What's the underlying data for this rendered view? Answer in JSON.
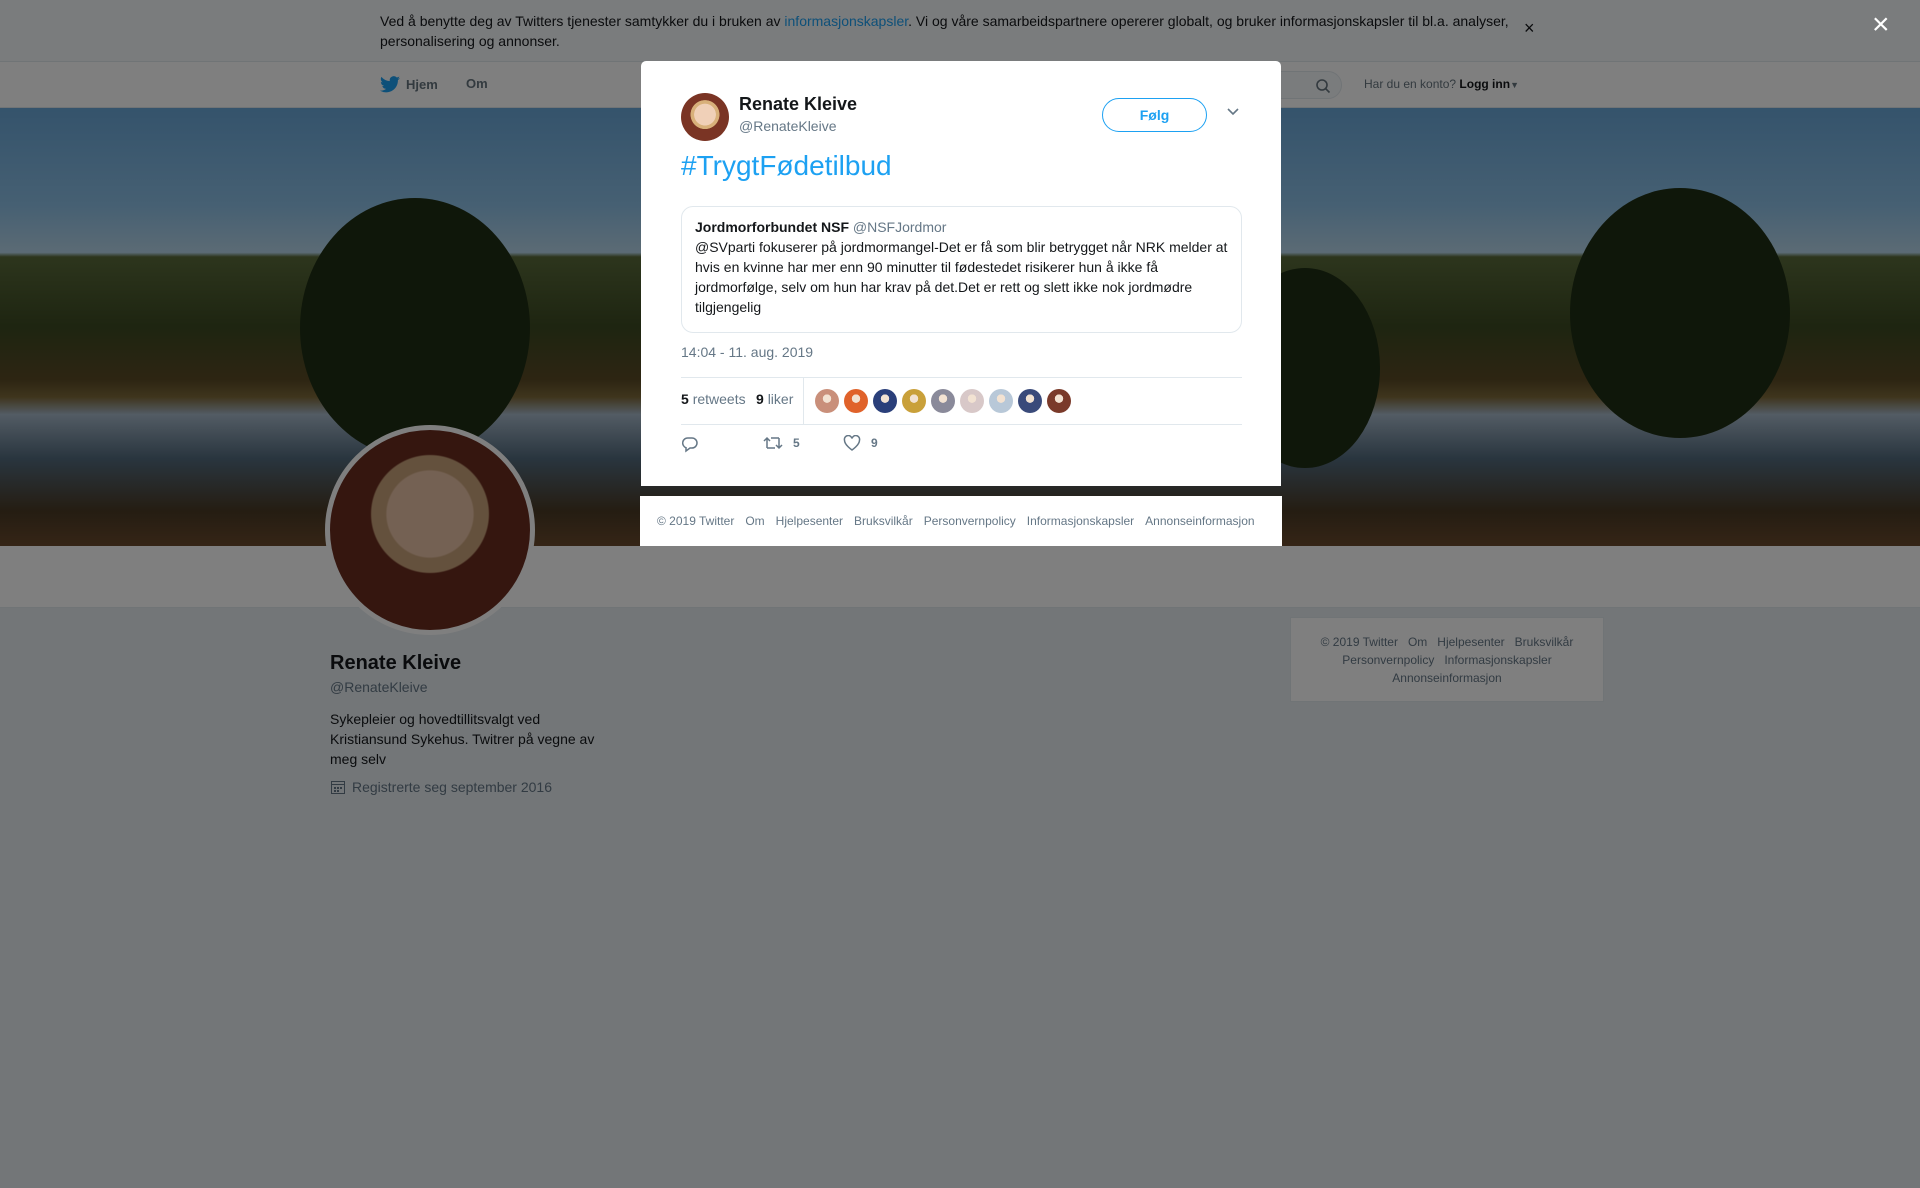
{
  "cookie_bar": {
    "text_before": "Ved å benytte deg av Twitters tjenester samtykker du i bruken av ",
    "link": "informasjonskapsler",
    "text_after": ". Vi og våre samarbeidspartnere opererer globalt, og bruker informasjonskapsler til bl.a. analyser, personalisering og annonser.",
    "close": "×"
  },
  "nav": {
    "home": "Hjem",
    "about": "Om",
    "account_prompt": "Har du en konto?",
    "login": "Logg inn"
  },
  "profile": {
    "name": "Renate Kleive",
    "handle": "@RenateKleive",
    "bio": "Sykepleier og hovedtillitsvalgt ved Kristiansund Sykehus. Twitrer på vegne av meg selv",
    "joined": "Registrerte seg september 2016"
  },
  "side_footer": [
    "© 2019 Twitter",
    "Om",
    "Hjelpesenter",
    "Bruksvilkår",
    "Personvernpolicy",
    "Informasjonskapsler",
    "Annonseinformasjon"
  ],
  "overlay": {
    "close": "×"
  },
  "tweet": {
    "author_name": "Renate Kleive",
    "author_handle": "@RenateKleive",
    "follow_label": "Følg",
    "text": "#TrygtFødetilbud",
    "quoted": {
      "name": "Jordmorforbundet NSF",
      "handle": "@NSFJordmor",
      "text": "@SVparti fokuserer på jordmormangel-Det er få som blir betrygget når NRK melder at hvis en kvinne har mer enn 90 minutter til fødestedet risikerer hun å ikke få jordmorfølge, selv om hun har krav på det.Det er rett og slett ikke nok jordmødre tilgjengelig"
    },
    "timestamp": "14:04 - 11. aug. 2019",
    "retweets_count": "5",
    "retweets_label": "retweets",
    "likes_count": "9",
    "likes_label": "liker",
    "retweet_action_count": "5",
    "like_action_count": "9",
    "liker_avatar_colors": [
      "#c98f7a",
      "#e0622a",
      "#2a3f7a",
      "#c9a03a",
      "#8a8a9a",
      "#d8c8c8",
      "#b8c8d8",
      "#3a4a7a",
      "#7a3a2a"
    ]
  },
  "modal_footer": [
    "© 2019 Twitter",
    "Om",
    "Hjelpesenter",
    "Bruksvilkår",
    "Personvernpolicy",
    "Informasjonskapsler",
    "Annonseinformasjon"
  ],
  "colors": {
    "accent": "#1da1f2",
    "muted": "#657786",
    "text": "#14171a"
  }
}
